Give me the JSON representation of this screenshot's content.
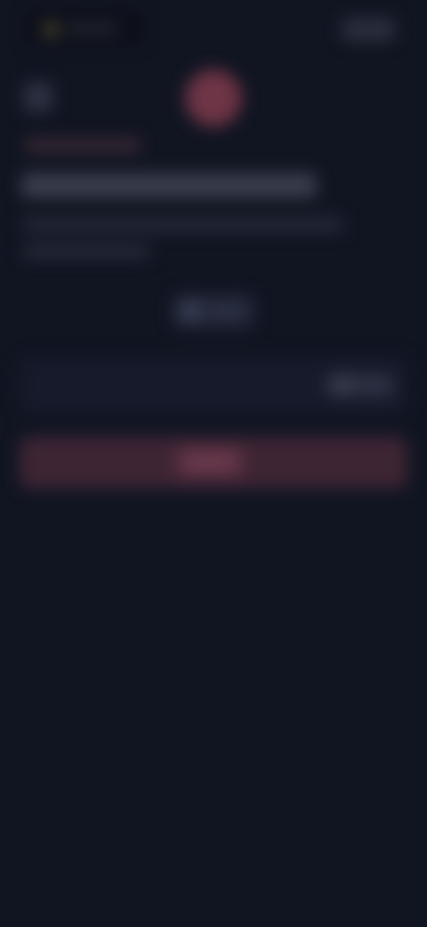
{
  "header": {
    "logo_icon": "app-logo-icon",
    "brand_text": "",
    "action_label": ""
  },
  "hero": {
    "back_icon": "back-icon",
    "avatar_icon": "avatar-icon",
    "eyebrow": "",
    "title": "",
    "description_line_1": "",
    "description_line_2": ""
  },
  "selector": {
    "icon": "token-icon",
    "label": ""
  },
  "amount": {
    "placeholder": "",
    "badge_icon": "token-icon",
    "badge_label": ""
  },
  "primary_action": {
    "label": ""
  },
  "colors": {
    "background": "#111522",
    "accent": "#6e3546",
    "button": "#3e2534"
  }
}
